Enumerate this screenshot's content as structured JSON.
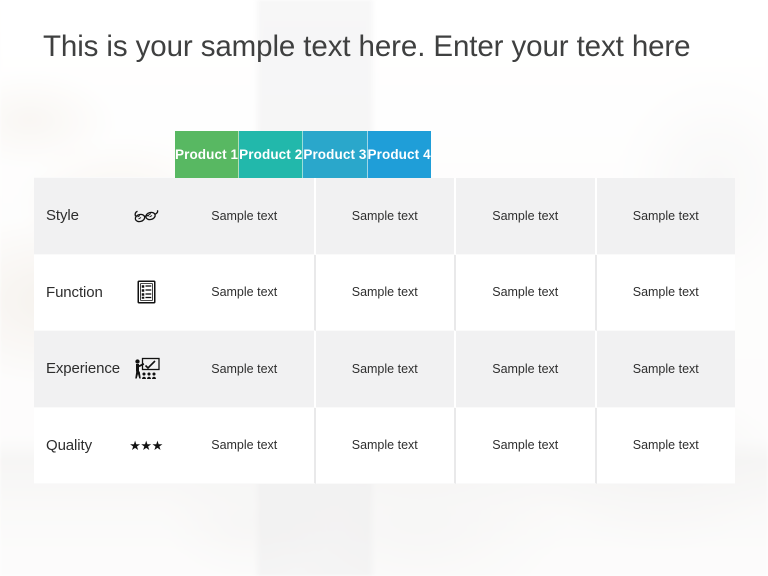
{
  "slide": {
    "title": "This is your sample text here. Enter your text here"
  },
  "table": {
    "corner_label": "",
    "columns": [
      {
        "label": "Product 1",
        "color": "#58b862"
      },
      {
        "label": "Product 2",
        "color": "#22b8ab"
      },
      {
        "label": "Product 3",
        "color": "#2aa7cb"
      },
      {
        "label": "Product 4",
        "color": "#1f9ed8"
      }
    ],
    "rows": [
      {
        "label": "Style",
        "icon": "glasses-icon",
        "cells": [
          "Sample text",
          "Sample text",
          "Sample text",
          "Sample text"
        ]
      },
      {
        "label": "Function",
        "icon": "checklist-icon",
        "cells": [
          "Sample text",
          "Sample text",
          "Sample text",
          "Sample text"
        ]
      },
      {
        "label": "Experience",
        "icon": "presentation-training-icon",
        "cells": [
          "Sample text",
          "Sample text",
          "Sample text",
          "Sample text"
        ]
      },
      {
        "label": "Quality",
        "icon": "three-stars-icon",
        "cells": [
          "Sample text",
          "Sample text",
          "Sample text",
          "Sample text"
        ],
        "stars": "★★★"
      }
    ]
  },
  "theme": {
    "title_color": "#3f4040",
    "row_shade": "#f1f1f2",
    "row_plain": "#ffffff",
    "header_text": "#ffffff",
    "body_text": "#2f2f2f"
  }
}
